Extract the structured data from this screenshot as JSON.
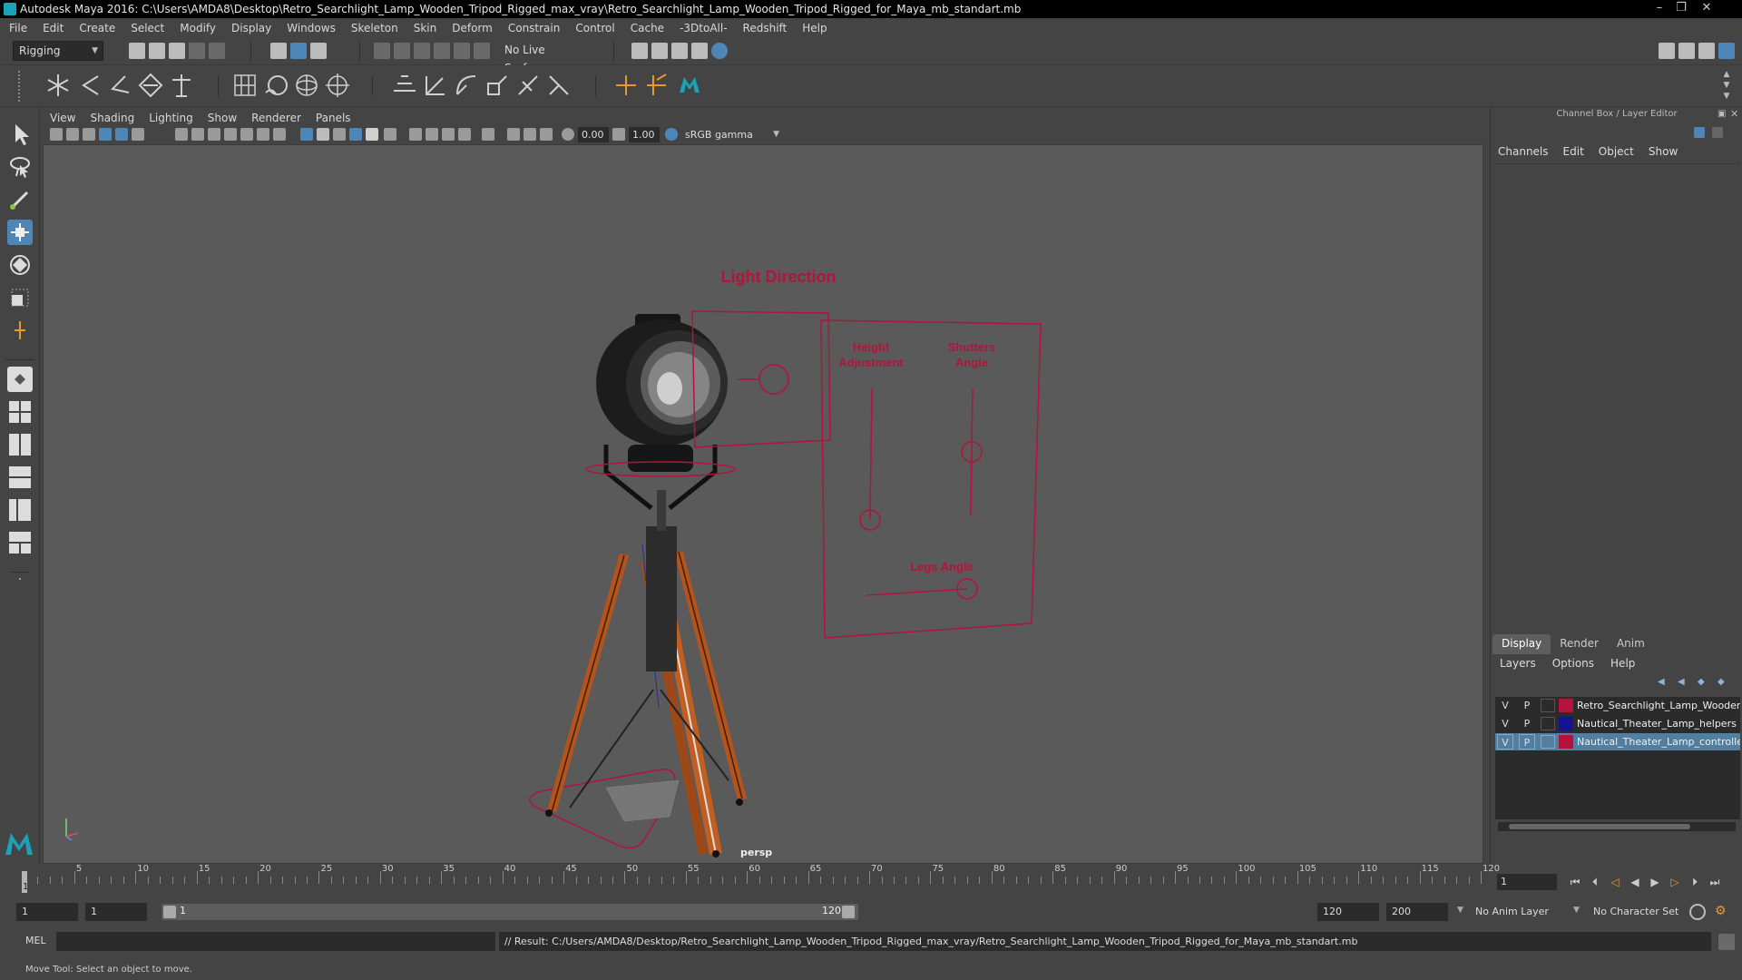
{
  "window": {
    "title": "Autodesk Maya 2016: C:\\Users\\AMDA8\\Desktop\\Retro_Searchlight_Lamp_Wooden_Tripod_Rigged_max_vray\\Retro_Searchlight_Lamp_Wooden_Tripod_Rigged_for_Maya_mb_standart.mb",
    "controls": [
      "–",
      "❐",
      "✕"
    ]
  },
  "menubar": [
    "File",
    "Edit",
    "Create",
    "Select",
    "Modify",
    "Display",
    "Windows",
    "Skeleton",
    "Skin",
    "Deform",
    "Constrain",
    "Control",
    "Cache",
    "-3DtoAll-",
    "Redshift",
    "Help"
  ],
  "status_line": {
    "menuset": "Rigging",
    "live_surface": "No Live Surface"
  },
  "panel": {
    "menu": [
      "View",
      "Shading",
      "Lighting",
      "Show",
      "Renderer",
      "Panels"
    ],
    "exposure": "0.00",
    "gamma": "1.00",
    "color_space": "sRGB gamma"
  },
  "viewport": {
    "camera": "persp",
    "rig_labels": {
      "light_direction": "Light Direction",
      "height_adjustment": "Height\nAdjustment",
      "shutters_angle": "Shutters\nAngle",
      "legs_angle": "Legs Angle"
    },
    "rig_color": "#b3133c"
  },
  "channel_box": {
    "title": "Channel Box / Layer Editor",
    "menu": [
      "Channels",
      "Edit",
      "Object",
      "Show"
    ]
  },
  "layer_editor": {
    "tabs": [
      "Display",
      "Render",
      "Anim"
    ],
    "active_tab": "Display",
    "menu": [
      "Layers",
      "Options",
      "Help"
    ],
    "layers": [
      {
        "v": "V",
        "p": "P",
        "color": "#b3133c",
        "name": "Retro_Searchlight_Lamp_Wooden",
        "selected": false
      },
      {
        "v": "V",
        "p": "P",
        "color": "#14148c",
        "name": "Nautical_Theater_Lamp_helpers",
        "selected": false
      },
      {
        "v": "V",
        "p": "P",
        "color": "#b3133c",
        "name": "Nautical_Theater_Lamp_controllers",
        "selected": true
      }
    ]
  },
  "time_slider": {
    "labels": [
      "1",
      "5",
      "10",
      "15",
      "20",
      "25",
      "30",
      "35",
      "40",
      "45",
      "50",
      "55",
      "60",
      "65",
      "70",
      "75",
      "80",
      "85",
      "90",
      "95",
      "100",
      "105",
      "110",
      "115",
      "120"
    ],
    "current_frame": "1"
  },
  "range_slider": {
    "start": "1",
    "playback_start": "1",
    "slider_start": "1",
    "slider_end": "120",
    "playback_end": "120",
    "end": "200",
    "anim_layer": "No Anim Layer",
    "character_set": "No Character Set"
  },
  "command_line": {
    "language": "MEL",
    "result": "// Result: C:/Users/AMDA8/Desktop/Retro_Searchlight_Lamp_Wooden_Tripod_Rigged_max_vray/Retro_Searchlight_Lamp_Wooden_Tripod_Rigged_for_Maya_mb_standart.mb"
  },
  "help_line": "Move Tool: Select an object to move."
}
